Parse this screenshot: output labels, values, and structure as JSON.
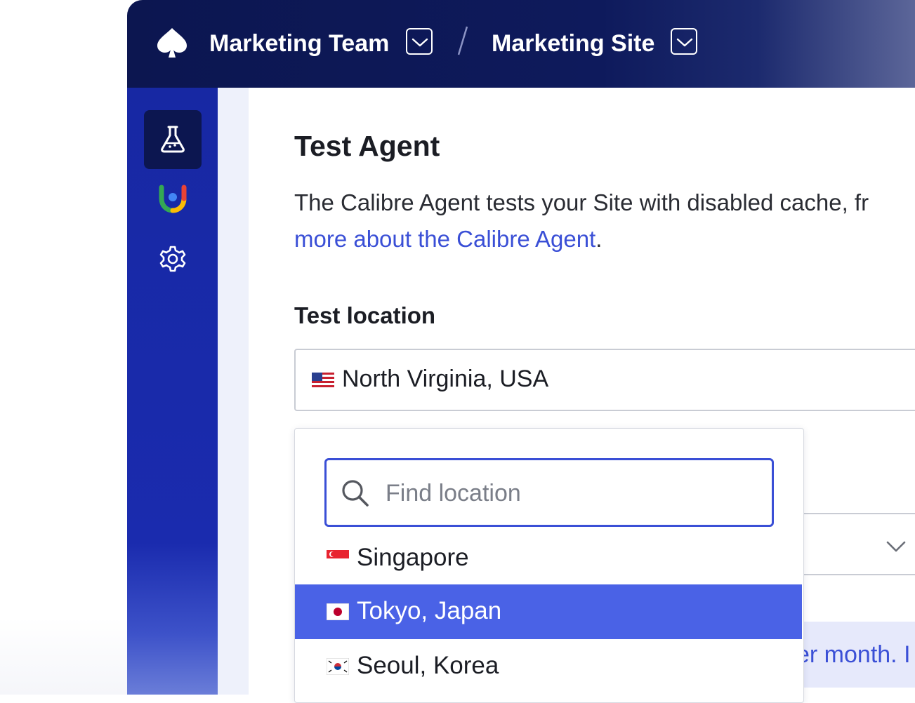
{
  "header": {
    "team_name": "Marketing Team",
    "separator": "/",
    "site_name": "Marketing Site"
  },
  "sidebar": {
    "items": [
      {
        "icon": "flask-icon",
        "active": true
      },
      {
        "icon": "lighthouse-logo-icon",
        "active": false
      },
      {
        "icon": "gear-icon",
        "active": false
      }
    ]
  },
  "main": {
    "title": "Test Agent",
    "description_line1": "The Calibre Agent tests your Site with disabled cache, fr",
    "description_link": "more about the Calibre Agent",
    "description_end": ".",
    "test_location_label": "Test location",
    "selected_location": "North Virginia, USA",
    "banner_partial_text": "er month. I"
  },
  "dropdown": {
    "search_placeholder": "Find location",
    "options": [
      {
        "label": "Singapore",
        "flag": "sg"
      },
      {
        "label": "Tokyo, Japan",
        "flag": "jp",
        "highlighted": true
      },
      {
        "label": "Seoul, Korea",
        "flag": "kr"
      }
    ]
  },
  "colors": {
    "topbar": "#0c1650",
    "sidebar": "#1a2bae",
    "accent": "#3a4fd6",
    "highlight": "#4a62e6"
  }
}
